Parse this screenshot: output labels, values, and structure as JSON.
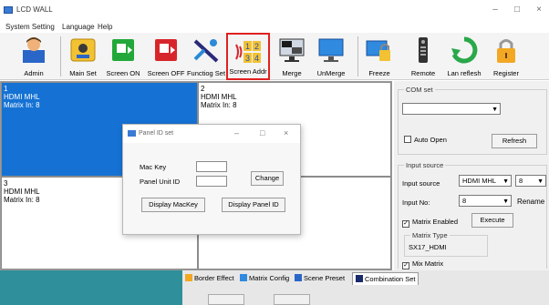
{
  "window": {
    "title": "LCD WALL",
    "minimize": "–",
    "maximize": "□",
    "close": "×"
  },
  "menu": [
    "System Setting",
    "Language",
    "Help"
  ],
  "toolbar": {
    "admin": "Admin",
    "main_set": "Main Set",
    "screen_on": "Screen ON",
    "screen_off": "Screen OFF",
    "function_set": "Functiog Set",
    "screen_addr": "Screen Addr",
    "screen_addr_digits": [
      "1",
      "2",
      "3",
      "4"
    ],
    "merge": "Merge",
    "unmerge": "UnMerge",
    "freeze": "Freeze",
    "remote": "Remote",
    "lan_refresh": "Lan reflesh",
    "register": "Register"
  },
  "cells": [
    {
      "num": "1",
      "src": "HDMI MHL",
      "matrix": "Matrix In: 8"
    },
    {
      "num": "2",
      "src": "HDMI MHL",
      "matrix": "Matrix In: 8"
    },
    {
      "num": "3",
      "src": "HDMI MHL",
      "matrix": "Matrix In: 8"
    }
  ],
  "com_set": {
    "label": "COM set",
    "port_value": "",
    "auto_open": "Auto Open",
    "refresh": "Refresh"
  },
  "input_source": {
    "label": "Input source",
    "source_label": "Input source",
    "source_value": "HDMI MHL",
    "source_num": "8",
    "input_no_label": "Input No:",
    "input_no_value": "8",
    "rename": "Rename",
    "matrix_enabled": "Matrix Enabled",
    "execute": "Execute",
    "matrix_type_label": "Matrix Type",
    "matrix_type_value": "SX17_HDMI",
    "mix_matrix": "Mix Matrix"
  },
  "dialog": {
    "title": "Panel ID set",
    "minimize": "–",
    "maximize": "□",
    "close": "×",
    "mac_key": "Mac Key",
    "panel_unit_id": "Panel Unit ID",
    "change": "Change",
    "display_mackey": "Display MacKey",
    "display_panel_id": "Display Panel ID"
  },
  "tabs": [
    "Border Effect",
    "Matrix Config",
    "Scene Preset",
    "Combination Set"
  ],
  "colors": {
    "selection": "#1572d4",
    "highlight_border": "#e02020",
    "teal": "#2f8f9a"
  }
}
